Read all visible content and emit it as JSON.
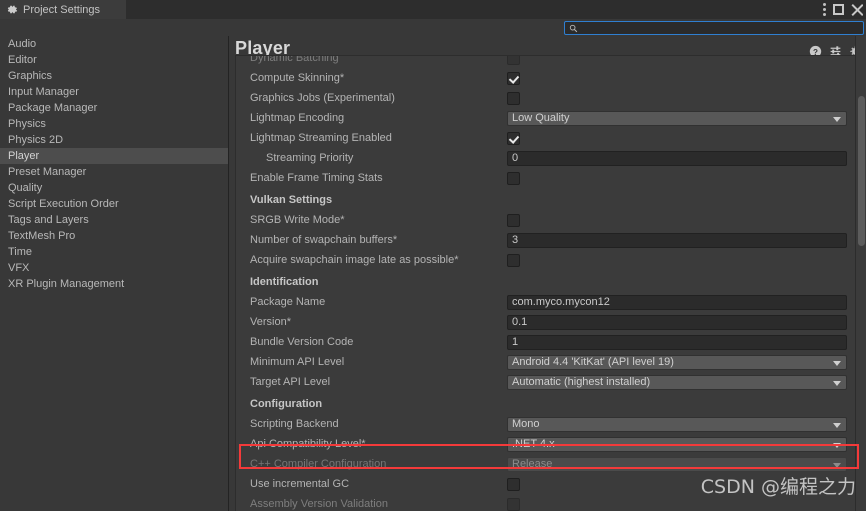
{
  "window": {
    "tab_title": "Project Settings",
    "tab_icon": "gear-icon",
    "controls": {
      "menu": "kebab-menu-icon",
      "maximize": "maximize-icon",
      "close": "close-icon"
    }
  },
  "search": {
    "placeholder": "",
    "value": "",
    "icon": "search-icon"
  },
  "sidebar": {
    "items": [
      {
        "label": "Audio",
        "selected": false
      },
      {
        "label": "Editor",
        "selected": false
      },
      {
        "label": "Graphics",
        "selected": false
      },
      {
        "label": "Input Manager",
        "selected": false
      },
      {
        "label": "Package Manager",
        "selected": false
      },
      {
        "label": "Physics",
        "selected": false
      },
      {
        "label": "Physics 2D",
        "selected": false
      },
      {
        "label": "Player",
        "selected": true
      },
      {
        "label": "Preset Manager",
        "selected": false
      },
      {
        "label": "Quality",
        "selected": false
      },
      {
        "label": "Script Execution Order",
        "selected": false
      },
      {
        "label": "Tags and Layers",
        "selected": false
      },
      {
        "label": "TextMesh Pro",
        "selected": false
      },
      {
        "label": "Time",
        "selected": false
      },
      {
        "label": "VFX",
        "selected": false
      },
      {
        "label": "XR Plugin Management",
        "selected": false
      }
    ]
  },
  "panel": {
    "title": "Player",
    "header_icons": [
      {
        "name": "help-icon",
        "title": "Help"
      },
      {
        "name": "preset-icon",
        "title": "Presets"
      },
      {
        "name": "gear-icon",
        "title": "Settings"
      }
    ]
  },
  "rows": [
    {
      "label": "Dynamic Batching",
      "type": "checkbox",
      "checked": false,
      "clipped": true
    },
    {
      "label": "Compute Skinning*",
      "type": "checkbox",
      "checked": true
    },
    {
      "label": "Graphics Jobs (Experimental)",
      "type": "checkbox",
      "checked": false
    },
    {
      "label": "Lightmap Encoding",
      "type": "dropdown",
      "value": "Low Quality"
    },
    {
      "label": "Lightmap Streaming Enabled",
      "type": "checkbox",
      "checked": true
    },
    {
      "label": "Streaming Priority",
      "type": "field",
      "value": "0",
      "indent": true
    },
    {
      "label": "Enable Frame Timing Stats",
      "type": "checkbox",
      "checked": false
    },
    {
      "label": "Vulkan Settings",
      "type": "group"
    },
    {
      "label": "SRGB Write Mode*",
      "type": "checkbox",
      "checked": false
    },
    {
      "label": "Number of swapchain buffers*",
      "type": "field",
      "value": "3"
    },
    {
      "label": "Acquire swapchain image late as possible*",
      "type": "checkbox",
      "checked": false
    },
    {
      "label": "Identification",
      "type": "group"
    },
    {
      "label": "Package Name",
      "type": "field",
      "value": "com.myco.mycon12"
    },
    {
      "label": "Version*",
      "type": "field",
      "value": "0.1"
    },
    {
      "label": "Bundle Version Code",
      "type": "field",
      "value": "1"
    },
    {
      "label": "Minimum API Level",
      "type": "dropdown",
      "value": "Android 4.4 'KitKat' (API level 19)"
    },
    {
      "label": "Target API Level",
      "type": "dropdown",
      "value": "Automatic (highest installed)"
    },
    {
      "label": "Configuration",
      "type": "group"
    },
    {
      "label": "Scripting Backend",
      "type": "dropdown",
      "value": "Mono"
    },
    {
      "label": "Api Compatibility Level*",
      "type": "dropdown",
      "value": ".NET 4.x",
      "highlighted": true
    },
    {
      "label": "C++ Compiler Configuration",
      "type": "dropdown",
      "value": "Release",
      "disabled": true
    },
    {
      "label": "Use incremental GC",
      "type": "checkbox",
      "checked": false
    },
    {
      "label": "Assembly Version Validation",
      "type": "checkbox",
      "checked": false,
      "clipped": true
    }
  ],
  "annotation": {
    "highlight_color": "#f43a3a",
    "target_row": "Api Compatibility Level*"
  },
  "watermark": {
    "text": "CSDN @编程之力"
  }
}
